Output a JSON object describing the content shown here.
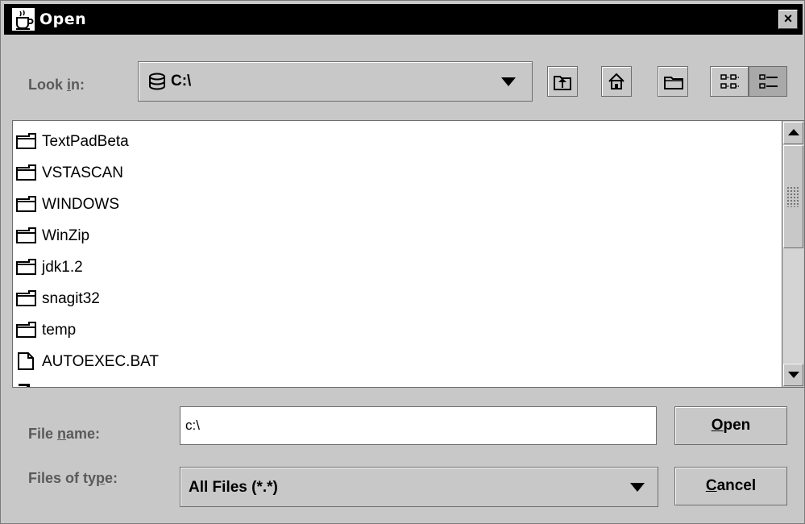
{
  "window": {
    "title": "Open",
    "close_glyph": "×"
  },
  "look_in": {
    "label": "Look in:",
    "value": "C:\\",
    "icon": "drive-icon"
  },
  "toolbar": {
    "buttons": [
      {
        "name": "up-one-level-button",
        "icon": "up-folder-icon"
      },
      {
        "name": "home-button",
        "icon": "home-icon"
      },
      {
        "name": "new-folder-button",
        "icon": "new-folder-icon"
      }
    ],
    "view_buttons": [
      {
        "name": "list-view-button",
        "icon": "list-view-icon",
        "selected": false
      },
      {
        "name": "details-view-button",
        "icon": "details-view-icon",
        "selected": true
      }
    ]
  },
  "files": [
    {
      "name": "TextPadBeta",
      "type": "folder"
    },
    {
      "name": "VSTASCAN",
      "type": "folder"
    },
    {
      "name": "WINDOWS",
      "type": "folder"
    },
    {
      "name": "WinZip",
      "type": "folder"
    },
    {
      "name": "jdk1.2",
      "type": "folder"
    },
    {
      "name": "snagit32",
      "type": "folder"
    },
    {
      "name": "temp",
      "type": "folder"
    },
    {
      "name": "AUTOEXEC.BAT",
      "type": "file"
    }
  ],
  "file_name": {
    "label": "File name:",
    "value": "c:\\"
  },
  "file_type": {
    "label": "Files of type:",
    "value": "All Files (*.*)"
  },
  "buttons": {
    "open_label_mnemonic": "O",
    "open_label_rest": "pen",
    "cancel_label_mnemonic": "C",
    "cancel_label_rest": "ancel"
  },
  "colors": {
    "title_bar": "#000000",
    "dialog_bg": "#c8c8c8",
    "list_bg": "#ffffff"
  }
}
